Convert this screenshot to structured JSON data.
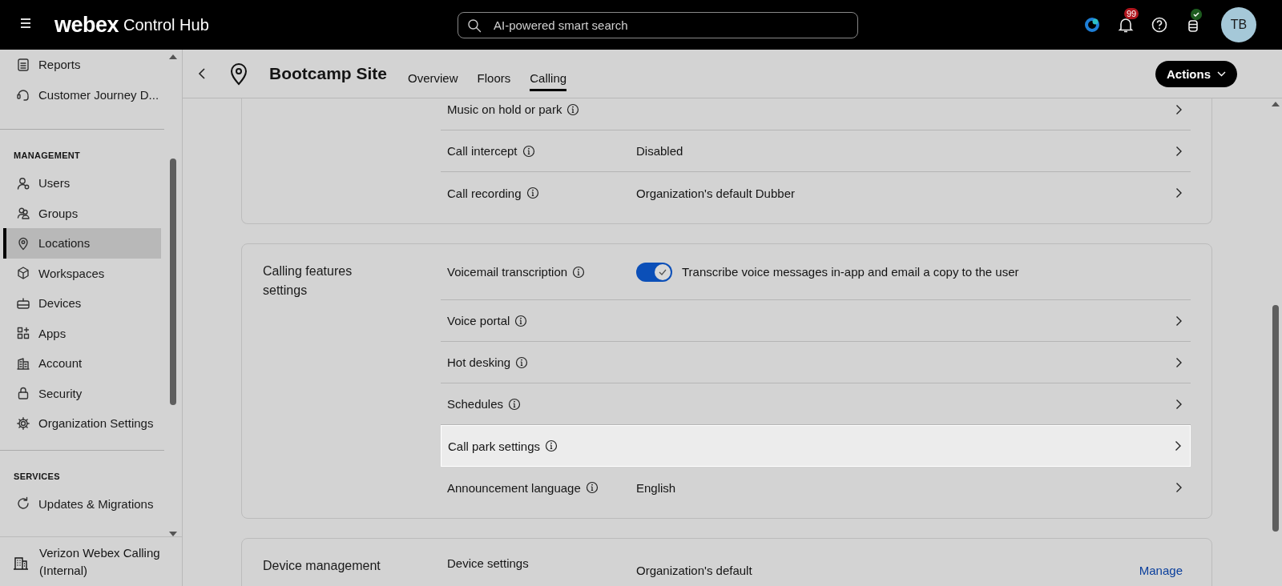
{
  "topbar": {
    "brand": "webex",
    "product": "Control Hub",
    "search": {
      "placeholder": "AI-powered smart search"
    },
    "notification_count": "99",
    "avatar": "TB"
  },
  "sidebar": {
    "items": [
      {
        "kind": "reports",
        "label": "Reports",
        "selected": false
      },
      {
        "kind": "journey",
        "label": "Customer Journey D...",
        "selected": false
      }
    ],
    "sections": [
      {
        "title": "MANAGEMENT",
        "items": [
          {
            "kind": "users",
            "label": "Users",
            "selected": false
          },
          {
            "kind": "groups",
            "label": "Groups",
            "selected": false
          },
          {
            "kind": "locations",
            "label": "Locations",
            "selected": true
          },
          {
            "kind": "workspaces",
            "label": "Workspaces",
            "selected": false
          },
          {
            "kind": "devices",
            "label": "Devices",
            "selected": false
          },
          {
            "kind": "apps",
            "label": "Apps",
            "selected": false
          },
          {
            "kind": "account",
            "label": "Account",
            "selected": false
          },
          {
            "kind": "security",
            "label": "Security",
            "selected": false
          },
          {
            "kind": "settings",
            "label": "Organization Settings",
            "selected": false
          }
        ]
      },
      {
        "title": "SERVICES",
        "items": [
          {
            "kind": "updates",
            "label": "Updates & Migrations",
            "selected": false
          }
        ]
      }
    ],
    "org": "Verizon Webex Calling (Internal)"
  },
  "page": {
    "title": "Bootcamp Site",
    "tabs": [
      {
        "label": "Overview",
        "selected": false
      },
      {
        "label": "Floors",
        "selected": false
      },
      {
        "label": "Calling",
        "selected": true
      }
    ],
    "actions": "Actions"
  },
  "cards": [
    {
      "rows": [
        {
          "kind": "link",
          "label": "Music on hold or park",
          "info": true,
          "highlighted": false
        },
        {
          "kind": "link",
          "label": "Call intercept",
          "info": true,
          "value": "Disabled",
          "highlighted": false
        },
        {
          "kind": "link",
          "label": "Call recording",
          "info": true,
          "value": "Organization's default Dubber",
          "highlighted": false
        }
      ]
    },
    {
      "title": "Calling features settings",
      "rows": [
        {
          "kind": "toggle",
          "label": "Voicemail transcription",
          "info": true,
          "on": true,
          "description": "Transcribe voice messages in-app and email a copy to the user",
          "highlighted": false
        },
        {
          "kind": "link",
          "label": "Voice portal",
          "info": true,
          "highlighted": false
        },
        {
          "kind": "link",
          "label": "Hot desking",
          "info": true,
          "highlighted": false
        },
        {
          "kind": "link",
          "label": "Schedules",
          "info": true,
          "highlighted": false
        },
        {
          "kind": "link",
          "label": "Call park settings",
          "info": true,
          "highlighted": true
        },
        {
          "kind": "link",
          "label": "Announcement language",
          "info": true,
          "value": "English",
          "highlighted": false
        }
      ]
    },
    {
      "title": "Device management",
      "rows": [
        {
          "kind": "action",
          "label": "Device settings",
          "info": false,
          "value": "Organization's default",
          "action": "Manage",
          "highlighted": false
        }
      ]
    }
  ]
}
